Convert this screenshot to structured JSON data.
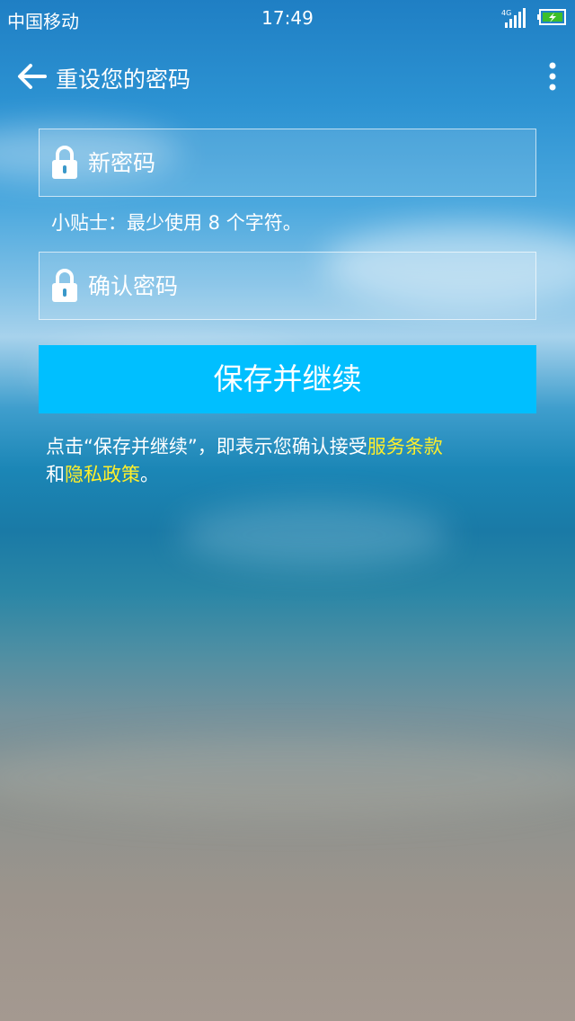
{
  "status_bar": {
    "carrier": "中国移动",
    "time": "17:49",
    "network": "4G",
    "icons": [
      "signal-icon",
      "battery-charging-icon"
    ]
  },
  "toolbar": {
    "title": "重设您的密码",
    "icons": [
      "back-arrow-icon",
      "more-vertical-icon"
    ]
  },
  "form": {
    "new_password": {
      "placeholder": "新密码",
      "value": "",
      "icon": "lock-icon"
    },
    "hint": "小贴士：最少使用 8 个字符。",
    "confirm_password": {
      "placeholder": "确认密码",
      "value": "",
      "icon": "lock-icon"
    },
    "save_label": "保存并继续"
  },
  "terms": {
    "prefix": "点击“保存并继续”，即表示您确认接受",
    "service_terms": "服务条款",
    "and": "和",
    "privacy_policy": "隐私政策",
    "suffix": "。"
  },
  "colors": {
    "button": "#00bfff",
    "link": "#ffef2a",
    "battery_fill": "#3cbf2a"
  }
}
